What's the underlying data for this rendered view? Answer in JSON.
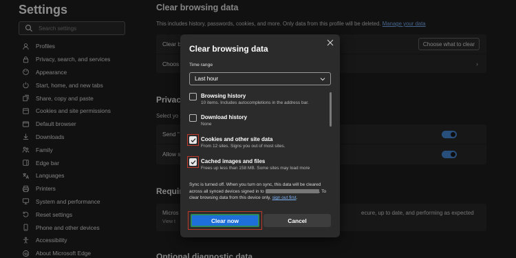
{
  "sidebar": {
    "title": "Settings",
    "search_placeholder": "Search settings",
    "items": [
      {
        "label": "Profiles",
        "icon": "profile-icon"
      },
      {
        "label": "Privacy, search, and services",
        "icon": "lock-icon"
      },
      {
        "label": "Appearance",
        "icon": "appearance-icon"
      },
      {
        "label": "Start, home, and new tabs",
        "icon": "power-icon"
      },
      {
        "label": "Share, copy and paste",
        "icon": "share-icon"
      },
      {
        "label": "Cookies and site permissions",
        "icon": "cookie-icon"
      },
      {
        "label": "Default browser",
        "icon": "browser-icon"
      },
      {
        "label": "Downloads",
        "icon": "download-icon"
      },
      {
        "label": "Family",
        "icon": "family-icon"
      },
      {
        "label": "Edge bar",
        "icon": "edge-bar-icon"
      },
      {
        "label": "Languages",
        "icon": "languages-icon"
      },
      {
        "label": "Printers",
        "icon": "printer-icon"
      },
      {
        "label": "System and performance",
        "icon": "system-icon"
      },
      {
        "label": "Reset settings",
        "icon": "reset-icon"
      },
      {
        "label": "Phone and other devices",
        "icon": "phone-icon"
      },
      {
        "label": "Accessibility",
        "icon": "accessibility-icon"
      },
      {
        "label": "About Microsoft Edge",
        "icon": "edge-icon"
      }
    ]
  },
  "main": {
    "title": "Clear browsing data",
    "desc": "This includes history, passwords, cookies, and more. Only data from this profile will be deleted.",
    "manage_link": "Manage your data",
    "row1_label": "Clear b",
    "choose_button": "Choose what to clear",
    "row2_label": "Choos",
    "privacy_title": "Privacy",
    "privacy_sub": "Select yo",
    "send_label": "Send \"",
    "allow_label": "Allow s",
    "required_title": "Requir",
    "micros_label": "Micros",
    "view_label": "View t",
    "secure_text": "ecure, up to date, and performing as expected",
    "bottom_title": "Optional diagnostic data"
  },
  "dialog": {
    "title": "Clear browsing data",
    "time_range_label": "Time range",
    "time_range_value": "Last hour",
    "options": [
      {
        "title": "Browsing history",
        "sub": "10 items. Includes autocompletions in the address bar.",
        "checked": false
      },
      {
        "title": "Download history",
        "sub": "None",
        "checked": false
      },
      {
        "title": "Cookies and other site data",
        "sub": "From 12 sites. Signs you out of most sites.",
        "checked": true
      },
      {
        "title": "Cached images and files",
        "sub": "Frees up less than 158 MB. Some sites may load more",
        "checked": true
      }
    ],
    "sync_line1": "Sync is turned off. When you turn on sync, this data will be cleared across all synced devices signed in to",
    "sync_line2": ". To clear browsing data from this device only,",
    "sync_link": "sign out first",
    "clear_button": "Clear now",
    "cancel_button": "Cancel"
  }
}
